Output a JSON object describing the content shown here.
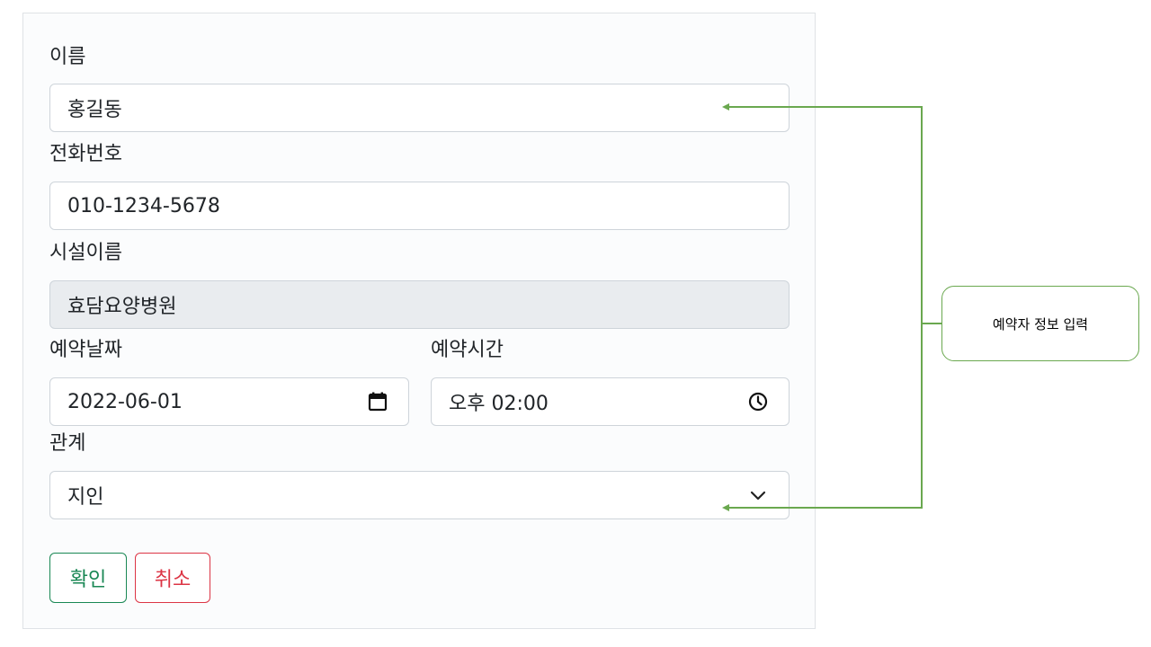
{
  "form": {
    "name_label": "이름",
    "name_value": "홍길동",
    "phone_label": "전화번호",
    "phone_value": "010-1234-5678",
    "facility_label": "시설이름",
    "facility_value": "효담요양병원",
    "date_label": "예약날짜",
    "date_value": "2022-06-01",
    "time_label": "예약시간",
    "time_value": "오후 02:00",
    "relation_label": "관계",
    "relation_value": "지인"
  },
  "buttons": {
    "confirm_label": "확인",
    "cancel_label": "취소"
  },
  "annotation": {
    "callout_text": "예약자 정보 입력"
  },
  "colors": {
    "confirm": "#198754",
    "cancel": "#dc3545",
    "annotation_line": "#6aa84f"
  },
  "icons": {
    "date": "calendar-icon",
    "time": "clock-icon",
    "select": "chevron-down-icon"
  }
}
